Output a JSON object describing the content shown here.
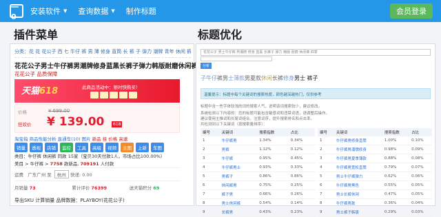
{
  "header": {
    "logo_text": "一0",
    "nav": [
      {
        "label": "安装软件"
      },
      {
        "label": "查询数据"
      },
      {
        "label": "制作标题"
      }
    ],
    "vip_label": "会员登录"
  },
  "sections": {
    "left_title": "插件菜单",
    "right_title": "标题优化"
  },
  "plugin": {
    "breadcrumb": "分类：花 花 花公子 西 七 牛仔 裤 男 薄 修身 直筒 长 裤 子 弹力 潮牌 青年 休闲 裤",
    "product_title": "花花公子男士牛仔裤男潮牌修身蓝黑长裤子弹力韩版耐磨休闲裤四季",
    "shop_name": "花花公子 品质保障",
    "banner": {
      "brand": "天猫",
      "event": "618",
      "text": "此商品活动中：限时快购买！"
    },
    "price": {
      "old_label": "价格",
      "old_price": "¥ 699.00",
      "new_label": "狂欢价",
      "new_price": "¥ 139.00",
      "badge": "618"
    },
    "row1": {
      "a": "淘宝指 商品性能分析",
      "b": "直通车(10) 图片",
      "c": "新品 挂 价格 高速"
    },
    "buttons": [
      {
        "label": "销量",
        "style": "b"
      },
      {
        "label": "透视",
        "style": "b"
      },
      {
        "label": "店铺",
        "style": "b"
      },
      {
        "label": "监控",
        "style": "g"
      },
      {
        "label": "工具",
        "style": "b"
      },
      {
        "label": "高级",
        "style": "b"
      },
      {
        "label": "视频",
        "style": "b"
      },
      {
        "label": "主图",
        "style": "o"
      },
      {
        "label": "上新",
        "style": "b"
      },
      {
        "label": "车图",
        "style": "b"
      }
    ],
    "row2": "类目：牛仔裤 休闲裤  同款 15家（宝贝30天付款1人，市场占比100.00%）",
    "row3": {
      "label": "美目 > 牛仔裤 >",
      "sales": "7758",
      "sales_unit": "款新品,",
      "count": "709191",
      "count_unit": "人付款"
    },
    "shipping": {
      "label": "运费",
      "from": "广东广州",
      "to_label": "至",
      "to": "杭州",
      "fee": "快递: 0.00"
    },
    "stats": [
      {
        "label": "月销量",
        "value": "73",
        "cls": "sv"
      },
      {
        "label": "累计评价",
        "value": "76399",
        "cls": "sv"
      },
      {
        "label": "送天猫积分",
        "value": "69",
        "cls": "gv"
      }
    ],
    "bottom_links": "导出SKU  计算销量  品牌数据：PLAYBOY(花花公子)"
  },
  "title_opt": {
    "input_text": "花花公子 男士牛仔裤 男潮牌 修身 蓝黑 长裤子 弹力 韩版 耐磨 休闲裤 四季",
    "button_label": "分析",
    "keyword_title": [
      {
        "text": "子牛仔",
        "cls": "c1"
      },
      {
        "text": "裤男",
        "cls": "c2"
      },
      {
        "text": "士薄款",
        "cls": "c1"
      },
      {
        "text": "男夏款",
        "cls": "c2"
      },
      {
        "text": "休闲",
        "cls": "c3"
      },
      {
        "text": "长裤",
        "cls": "c2"
      },
      {
        "text": "修身",
        "cls": "c1"
      },
      {
        "text": "男士 裤子",
        "cls": "c4"
      }
    ],
    "tip": "温馨提示：标题中每个关键词的搜索热度，颜色越深越热门，仅供参考",
    "paragraphs": [
      "标题中含一些字体较浅的词的搜索人气，说明该词搜索较少，建议修改。",
      "系统检测以下内容的：您的标题可能包含敏感词和违禁词语，请调整后操作。",
      "建议使用主推词和长尾词组合，注意词序，提升搜索排名和点击率。",
      "共检测到以下关键词（按搜索量排序）："
    ],
    "table_left_caption": "关键词",
    "table_right_caption": "关键词",
    "columns": [
      "编号",
      "关键词",
      "搜索指数",
      "占比"
    ],
    "rows_left": [
      {
        "no": "1",
        "kw": "牛仔裤男",
        "idx": "1.34%",
        "pct": "0.34%"
      },
      {
        "no": "2",
        "kw": "男裤",
        "idx": "1.12%",
        "pct": "0.12%"
      },
      {
        "no": "3",
        "kw": "牛仔裤",
        "idx": "0.95%",
        "pct": "0.45%"
      },
      {
        "no": "4",
        "kw": "牛仔裤男士",
        "idx": "0.93%",
        "pct": "0.33%"
      },
      {
        "no": "5",
        "kw": "男裤子",
        "idx": "0.86%",
        "pct": "0.86%"
      },
      {
        "no": "6",
        "kw": "休闲裤男",
        "idx": "0.75%",
        "pct": "0.25%"
      },
      {
        "no": "7",
        "kw": "裤子男",
        "idx": "0.66%",
        "pct": "0.26%"
      },
      {
        "no": "8",
        "kw": "男士休闲裤",
        "idx": "0.54%",
        "pct": "0.14%"
      },
      {
        "no": "9",
        "kw": "长裤男",
        "idx": "0.43%",
        "pct": "0.23%"
      }
    ],
    "rows_right": [
      {
        "no": "1",
        "kw": "牛仔裤男修身直筒",
        "idx": "1.00%",
        "pct": "0.10%"
      },
      {
        "no": "2",
        "kw": "牛仔裤男潮牌修身",
        "idx": "0.98%",
        "pct": "0.09%"
      },
      {
        "no": "3",
        "kw": "牛仔裤男夏季薄款",
        "idx": "0.88%",
        "pct": "0.08%"
      },
      {
        "no": "4",
        "kw": "牛仔裤男宽松直筒",
        "idx": "0.79%",
        "pct": "0.07%"
      },
      {
        "no": "5",
        "kw": "男士牛仔裤弹力",
        "idx": "0.62%",
        "pct": "0.06%"
      },
      {
        "no": "6",
        "kw": "牛仔裤男黑色",
        "idx": "0.55%",
        "pct": "0.05%"
      },
      {
        "no": "7",
        "kw": "男士长裤休闲",
        "idx": "0.47%",
        "pct": "0.05%"
      },
      {
        "no": "8",
        "kw": "牛仔裤男款",
        "idx": "0.36%",
        "pct": "0.04%"
      },
      {
        "no": "9",
        "kw": "男士裤子韩版",
        "idx": "0.29%",
        "pct": "0.03%"
      }
    ]
  },
  "colors": {
    "brand_blue": "#2497e8",
    "vip_green": "#5cb85c",
    "price_red": "#e41b2c"
  }
}
